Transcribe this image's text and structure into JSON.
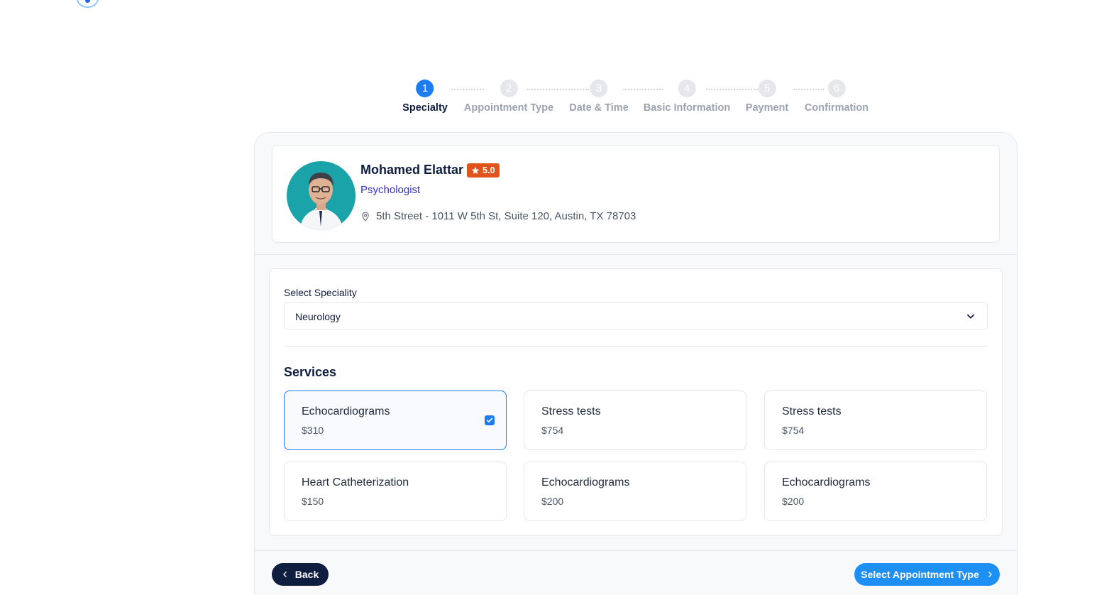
{
  "stepper": {
    "steps": [
      {
        "num": "1",
        "label": "Specialty"
      },
      {
        "num": "2",
        "label": "Appointment Type"
      },
      {
        "num": "3",
        "label": "Date & Time"
      },
      {
        "num": "4",
        "label": "Basic Information"
      },
      {
        "num": "5",
        "label": "Payment"
      },
      {
        "num": "6",
        "label": "Confirmation"
      }
    ],
    "active_step": "1"
  },
  "doctor": {
    "name": "Mohamed Elattar",
    "rating": "5.0",
    "specialty": "Psychologist",
    "address": "5th Street - 1011 W 5th St, Suite 120, Austin, TX 78703"
  },
  "form": {
    "speciality_label": "Select Speciality",
    "speciality_value": "Neurology",
    "services_title": "Services",
    "services": [
      {
        "name": "Echocardiograms",
        "price": "$310",
        "selected": true
      },
      {
        "name": "Stress tests",
        "price": "$754",
        "selected": false
      },
      {
        "name": "Stress tests",
        "price": "$754",
        "selected": false
      },
      {
        "name": "Heart Catheterization",
        "price": "$150",
        "selected": false
      },
      {
        "name": "Echocardiograms",
        "price": "$200",
        "selected": false
      },
      {
        "name": "Echocardiograms",
        "price": "$200",
        "selected": false
      }
    ]
  },
  "footer": {
    "back_label": "Back",
    "next_label": "Select Appointment Type"
  },
  "colors": {
    "primary": "#1d7cf2",
    "navy": "#0f1d40",
    "rating_badge": "#e0541b",
    "specialty_text": "#3530c7",
    "avatar_bg": "#1aa3a8"
  },
  "icons": {
    "rating": "star-icon",
    "address": "map-pin-icon",
    "select": "chevron-down-icon",
    "selected": "checkbox-checked-icon",
    "back": "chevron-left-icon",
    "next": "chevron-right-icon"
  }
}
